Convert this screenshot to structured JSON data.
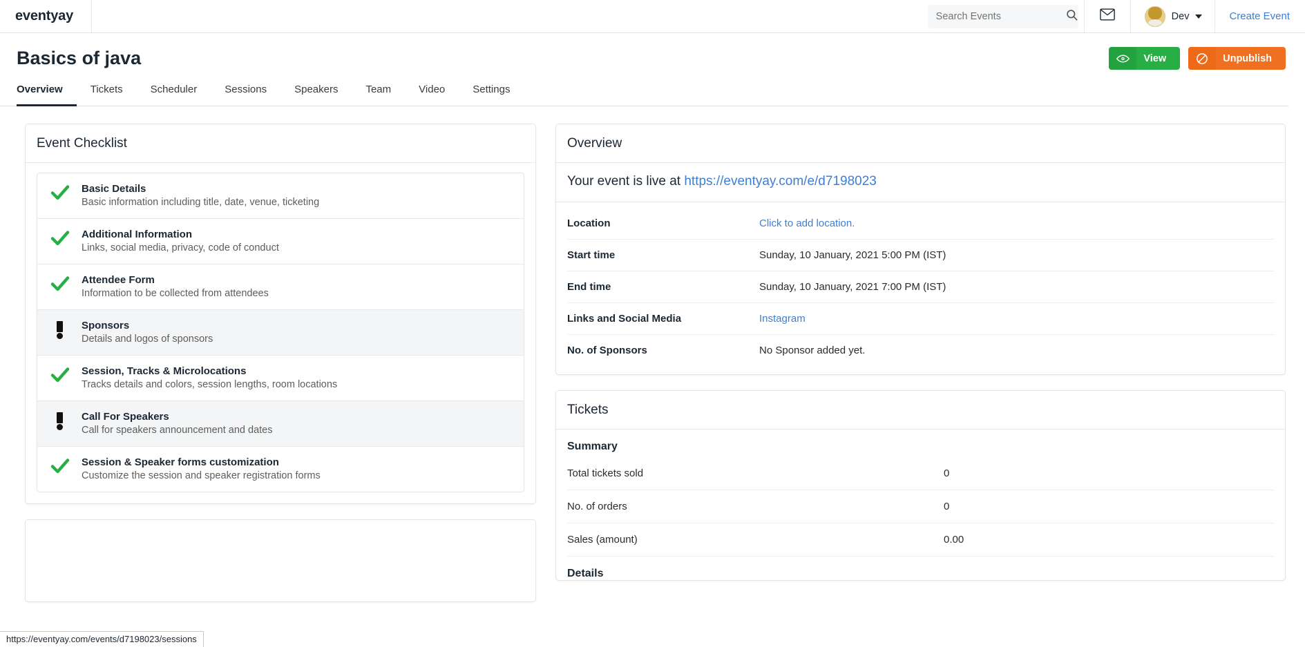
{
  "navbar": {
    "brand": "eventyay",
    "search_placeholder": "Search Events",
    "search_value": "",
    "mail_icon": "envelope-icon",
    "user_name": "Dev",
    "create_event": "Create Event"
  },
  "header": {
    "title": "Basics of java",
    "view_label": "View",
    "unpublish_label": "Unpublish"
  },
  "tabs": [
    {
      "label": "Overview",
      "active": true
    },
    {
      "label": "Tickets",
      "active": false
    },
    {
      "label": "Scheduler",
      "active": false
    },
    {
      "label": "Sessions",
      "active": false
    },
    {
      "label": "Speakers",
      "active": false
    },
    {
      "label": "Team",
      "active": false
    },
    {
      "label": "Video",
      "active": false
    },
    {
      "label": "Settings",
      "active": false
    }
  ],
  "checklist": {
    "card_title": "Event Checklist",
    "items": [
      {
        "status": "done",
        "title": "Basic Details",
        "desc": "Basic information including title, date, venue, ticketing"
      },
      {
        "status": "done",
        "title": "Additional Information",
        "desc": "Links, social media, privacy, code of conduct"
      },
      {
        "status": "done",
        "title": "Attendee Form",
        "desc": "Information to be collected from attendees"
      },
      {
        "status": "pending",
        "title": "Sponsors",
        "desc": "Details and logos of sponsors"
      },
      {
        "status": "done",
        "title": "Session, Tracks & Microlocations",
        "desc": "Tracks details and colors, session lengths, room locations"
      },
      {
        "status": "pending",
        "title": "Call For Speakers",
        "desc": "Call for speakers announcement and dates"
      },
      {
        "status": "done",
        "title": "Session & Speaker forms customization",
        "desc": "Customize the session and speaker registration forms"
      }
    ]
  },
  "overview": {
    "card_title": "Overview",
    "live_prefix": "Your event is live at",
    "live_url": "https://eventyay.com/e/d7198023",
    "rows": [
      {
        "key": "Location",
        "value": "Click to add location.",
        "link": true
      },
      {
        "key": "Start time",
        "value": "Sunday, 10 January, 2021 5:00 PM (IST)",
        "link": false
      },
      {
        "key": "End time",
        "value": "Sunday, 10 January, 2021 7:00 PM (IST)",
        "link": false
      },
      {
        "key": "Links and Social Media",
        "value": "Instagram",
        "link": true
      },
      {
        "key": "No. of Sponsors",
        "value": "No Sponsor added yet.",
        "link": false
      }
    ]
  },
  "tickets": {
    "card_title": "Tickets",
    "summary_title": "Summary",
    "rows": [
      {
        "key": "Total tickets sold",
        "value": "0"
      },
      {
        "key": "No. of orders",
        "value": "0"
      },
      {
        "key": "Sales (amount)",
        "value": "0.00"
      }
    ],
    "details_title": "Details"
  },
  "statusbar": {
    "url": "https://eventyay.com/events/d7198023/sessions"
  },
  "colors": {
    "green": "#27ae45",
    "orange": "#f07021",
    "link": "#3c7fd4",
    "pending_row_bg": "#f4f5f6"
  }
}
